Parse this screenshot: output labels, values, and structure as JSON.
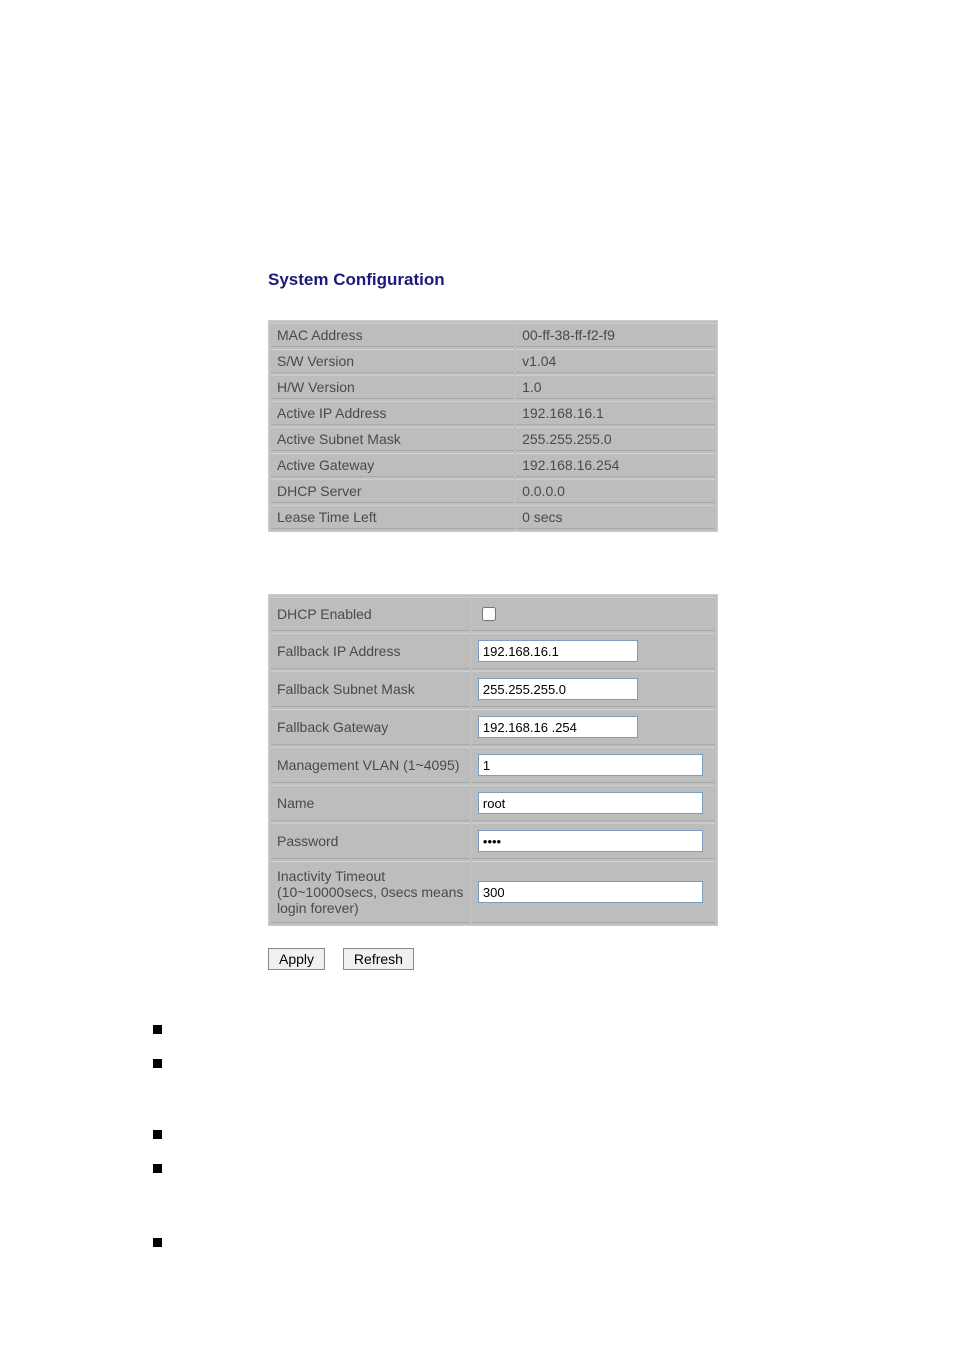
{
  "title": "System Configuration",
  "info": {
    "mac_address": {
      "label": "MAC Address",
      "value": "00-ff-38-ff-f2-f9"
    },
    "sw_version": {
      "label": "S/W Version",
      "value": "v1.04"
    },
    "hw_version": {
      "label": "H/W Version",
      "value": "1.0"
    },
    "active_ip": {
      "label": "Active IP Address",
      "value": "192.168.16.1"
    },
    "active_subnet": {
      "label": "Active Subnet Mask",
      "value": "255.255.255.0"
    },
    "active_gateway": {
      "label": "Active Gateway",
      "value": "192.168.16.254"
    },
    "dhcp_server": {
      "label": "DHCP Server",
      "value": "0.0.0.0"
    },
    "lease_time": {
      "label": "Lease Time Left",
      "value": "0 secs"
    }
  },
  "form": {
    "dhcp_enabled": {
      "label": "DHCP Enabled",
      "checked": false
    },
    "fallback_ip": {
      "label": "Fallback IP Address",
      "value": "192.168.16.1"
    },
    "fallback_subnet": {
      "label": "Fallback Subnet Mask",
      "value": "255.255.255.0"
    },
    "fallback_gateway": {
      "label": "Fallback Gateway",
      "value": "192.168.16 .254"
    },
    "mgmt_vlan": {
      "label": "Management VLAN (1~4095)",
      "value": "1"
    },
    "name": {
      "label": "Name",
      "value": "root"
    },
    "password": {
      "label": "Password",
      "value": "••••"
    },
    "inactivity_timeout": {
      "label": "Inactivity Timeout (10~10000secs, 0secs means login forever)",
      "value": "300"
    }
  },
  "buttons": {
    "apply": "Apply",
    "refresh": "Refresh"
  }
}
